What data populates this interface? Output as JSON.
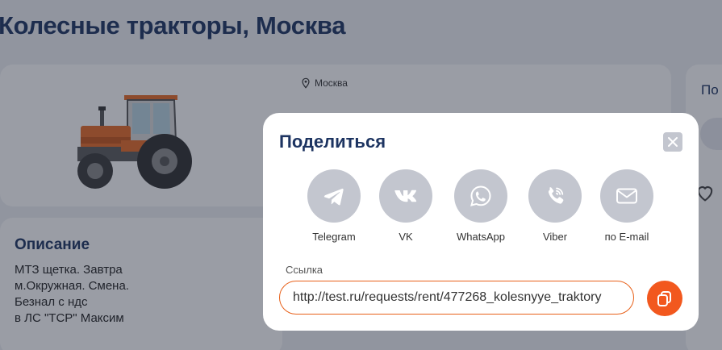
{
  "page": {
    "title": "Колесные тракторы, Москва"
  },
  "listing": {
    "location": "Москва",
    "image_icon": "tractor-image",
    "description_title": "Описание",
    "description_lines": [
      "МТЗ щетка. Завтра",
      "м.Окружная. Смена.",
      "Безнал с ндс",
      "в ЛС \"ТСР\" Максим"
    ]
  },
  "side_panel": {
    "heading_partial": "По",
    "favorite_icon": "heart-icon"
  },
  "share_modal": {
    "title": "Поделиться",
    "close_icon": "close-icon",
    "options": [
      {
        "label": "Telegram",
        "icon": "telegram-icon"
      },
      {
        "label": "VK",
        "icon": "vk-icon"
      },
      {
        "label": "WhatsApp",
        "icon": "whatsapp-icon"
      },
      {
        "label": "Viber",
        "icon": "viber-icon"
      },
      {
        "label": "по E-mail",
        "icon": "mail-icon"
      }
    ],
    "link_label": "Ссылка",
    "link_value": "http://test.ru/requests/rent/477268_kolesnyye_traktory",
    "copy_icon": "copy-icon"
  },
  "colors": {
    "brand_dark": "#1d3461",
    "accent_orange": "#f2581e",
    "icon_circle": "#c3c6cf"
  }
}
